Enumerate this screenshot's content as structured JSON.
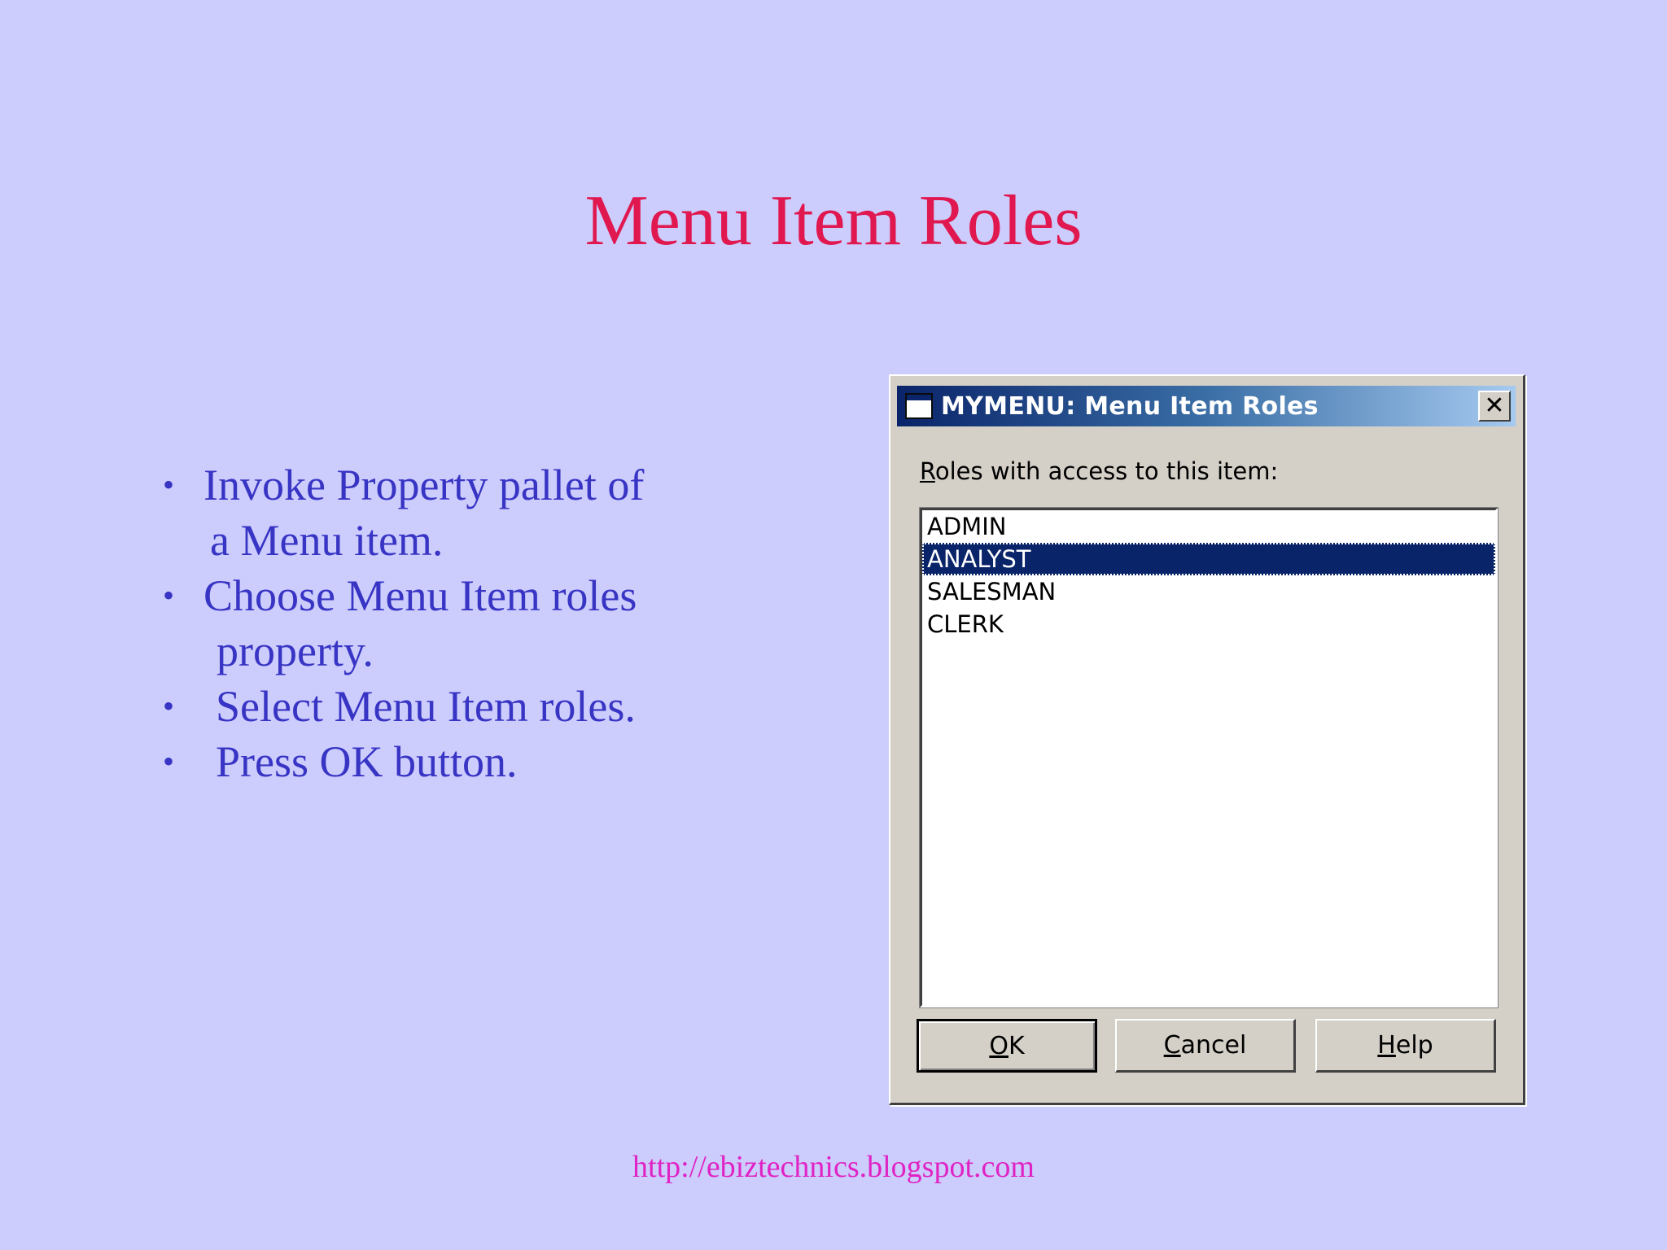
{
  "slide": {
    "title": "Menu Item Roles",
    "bullets": [
      {
        "lines": [
          "Invoke Property pallet of",
          "a Menu item."
        ]
      },
      {
        "lines": [
          "Choose Menu Item roles",
          "property."
        ]
      },
      {
        "lines": [
          "Select Menu Item roles."
        ]
      },
      {
        "lines": [
          "Press OK button."
        ]
      }
    ],
    "footer_link": "http://ebiztechnics.blogspot.com"
  },
  "dialog": {
    "title": "MYMENU: Menu Item Roles",
    "close_glyph": "✕",
    "list_label_mnemonic": "R",
    "list_label_rest": "oles with access to this item:",
    "roles": [
      "ADMIN",
      "ANALYST",
      "SALESMAN",
      "CLERK"
    ],
    "selected_role": "ANALYST",
    "buttons": {
      "ok": {
        "mnemonic": "O",
        "rest": "K"
      },
      "cancel": {
        "mnemonic": "C",
        "rest": "ancel"
      },
      "help": {
        "mnemonic": "H",
        "rest": "elp"
      }
    }
  },
  "colors": {
    "background": "#ccccfd",
    "title": "#e0184f",
    "bullet_text": "#3834c4",
    "footer_link": "#e023c4",
    "dialog_face": "#d4d0c8",
    "selection": "#0a246a"
  },
  "icons": {
    "app_icon": "window-icon",
    "close_icon": "close-icon",
    "bullet_icon": "bullet-dot"
  }
}
